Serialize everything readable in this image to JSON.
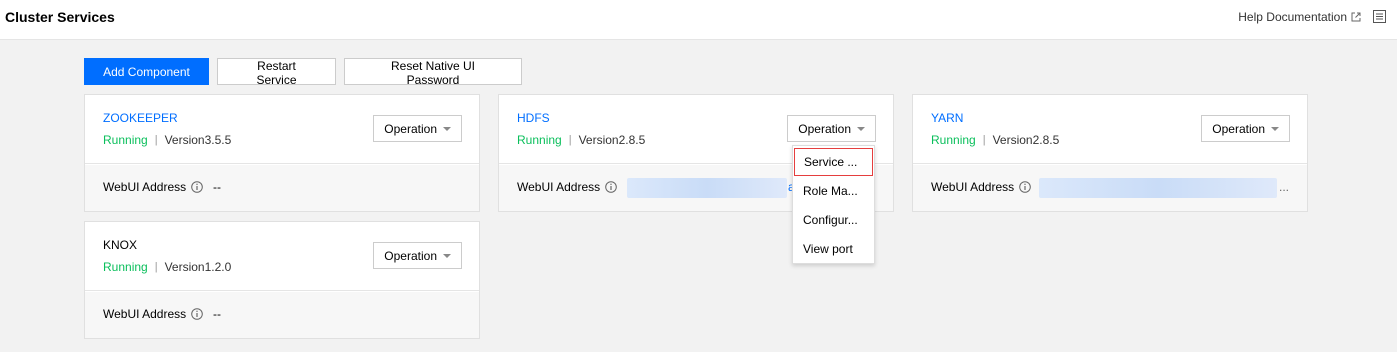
{
  "header": {
    "title": "Cluster Services",
    "help_label": "Help Documentation",
    "help_icon": "external-link-icon",
    "list_icon": "list-icon"
  },
  "toolbar": {
    "add_label": "Add Component",
    "restart_label": "Restart Service",
    "reset_label": "Reset Native UI Password"
  },
  "common": {
    "operation_label": "Operation",
    "webui_label": "WebUI Address",
    "status_sep": "|"
  },
  "services": [
    {
      "name": "ZOOKEEPER",
      "status": "Running",
      "version": "Version3.5.5",
      "webui": "--"
    },
    {
      "name": "HDFS",
      "status": "Running",
      "version": "Version2.8.5",
      "webui_tail": "a"
    },
    {
      "name": "YARN",
      "status": "Running",
      "version": "Version2.8.5",
      "webui_tail": "..."
    },
    {
      "name": "KNOX",
      "status": "Running",
      "version": "Version1.2.0",
      "webui": "--"
    }
  ],
  "dropdown": {
    "items": [
      "Service ...",
      "Role Ma...",
      "Configur...",
      "View port"
    ]
  },
  "colors": {
    "accent": "#006eff",
    "running": "#0abf5b",
    "highlight_border": "#e53e3e"
  }
}
